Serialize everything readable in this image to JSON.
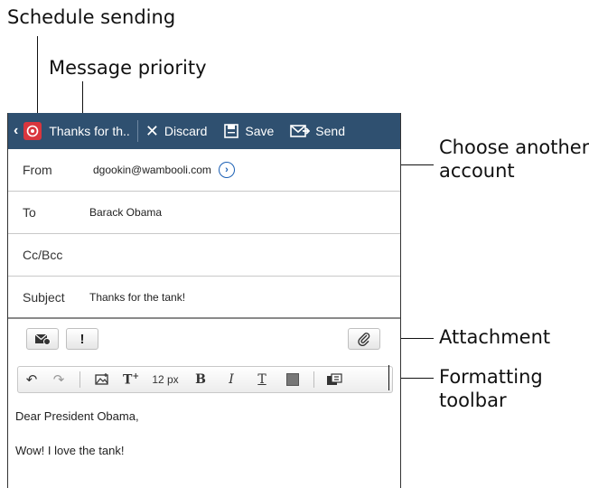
{
  "callouts": {
    "schedule": "Schedule sending",
    "priority": "Message priority",
    "account_line1": "Choose another",
    "account_line2": "account",
    "attachment": "Attachment",
    "format_line1": "Formatting",
    "format_line2": "toolbar"
  },
  "actionbar": {
    "title": "Thanks for th..",
    "discard": "Discard",
    "save": "Save",
    "send": "Send"
  },
  "fields": {
    "from_label": "From",
    "from_value": "dgookin@wambooli.com",
    "to_label": "To",
    "to_value": "Barack Obama",
    "ccbcc_label": "Cc/Bcc",
    "subject_label": "Subject",
    "subject_value": "Thanks for the tank!"
  },
  "format": {
    "size": "12 px",
    "bold": "B",
    "italic": "I",
    "underline": "T"
  },
  "body": {
    "line1": "Dear President Obama,",
    "line2": "Wow! I love the tank!"
  },
  "colors": {
    "actionbar": "#2f5070",
    "brand": "#d9363e",
    "link": "#1a5fb4"
  }
}
